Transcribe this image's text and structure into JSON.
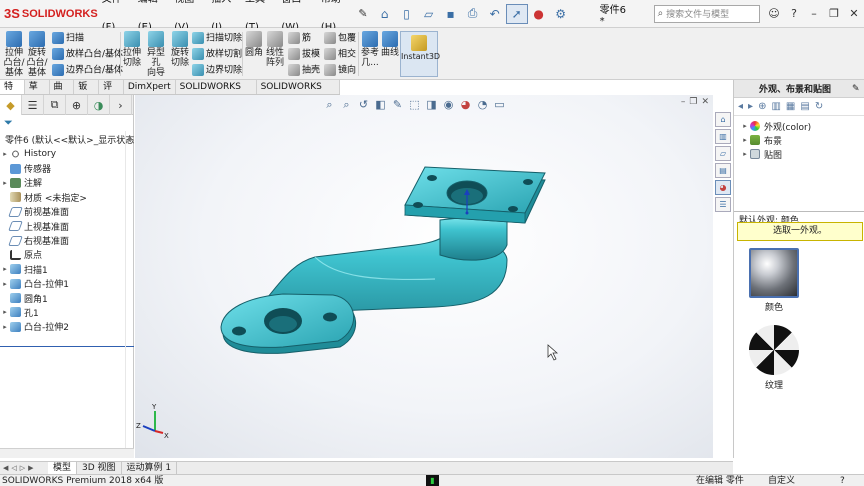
{
  "app": {
    "logo": "SOLIDWORKS",
    "logo_mark": "3S",
    "doc_title": "零件6 *",
    "search_placeholder": "搜索文件与模型"
  },
  "menu": [
    "文件(F)",
    "编辑(E)",
    "视图(V)",
    "插入(I)",
    "工具(T)",
    "窗口(W)",
    "帮助(H)"
  ],
  "ribbon": {
    "boss_extrude": [
      "拉伸",
      "凸台/",
      "基体"
    ],
    "boss_revolve": [
      "旋转",
      "凸台/",
      "基体"
    ],
    "sweep": "扫描",
    "loft": "放样凸台/基体",
    "boundary": "边界凸台/基体",
    "cut_extrude": [
      "拉伸",
      "切除"
    ],
    "hole_wizard": [
      "异型孔",
      "向导"
    ],
    "cut_revolve": [
      "旋转",
      "切除"
    ],
    "swept_cut": "扫描切除",
    "lofted_cut": "放样切割",
    "boundary_cut": "边界切除",
    "fillet": "圆角",
    "linear_pattern": [
      "线性",
      "阵列"
    ],
    "rib": "筋",
    "draft": "拔模",
    "shell": "抽壳",
    "wrap": "包覆",
    "intersect": "相交",
    "mirror": "镜向",
    "ref_geometry": [
      "参考",
      "几..."
    ],
    "curves": "曲线",
    "instant3d": "Instant3D"
  },
  "tabs": [
    "特征",
    "草图",
    "曲面",
    "钣金",
    "评估",
    "DimXpert",
    "SOLIDWORKS 插件",
    "SOLIDWORKS MBD"
  ],
  "feature_tree": {
    "root": "零件6 (默认<<默认>_显示状态",
    "items": [
      {
        "label": "History",
        "icon": "history-icon",
        "expand": true
      },
      {
        "label": "传感器",
        "icon": "sensor-icon",
        "expand": false
      },
      {
        "label": "注解",
        "icon": "annotation-icon",
        "expand": true
      },
      {
        "label": "材质 <未指定>",
        "icon": "material-icon",
        "expand": false
      },
      {
        "label": "前视基准面",
        "icon": "plane-icon",
        "expand": false
      },
      {
        "label": "上视基准面",
        "icon": "plane-icon",
        "expand": false
      },
      {
        "label": "右视基准面",
        "icon": "plane-icon",
        "expand": false
      },
      {
        "label": "原点",
        "icon": "origin-icon",
        "expand": false
      },
      {
        "label": "扫描1",
        "icon": "sweep-icon",
        "expand": true
      },
      {
        "label": "凸台-拉伸1",
        "icon": "extrude-icon",
        "expand": true
      },
      {
        "label": "圆角1",
        "icon": "fillet-icon",
        "expand": false
      },
      {
        "label": "孔1",
        "icon": "hole-icon",
        "expand": true
      },
      {
        "label": "凸台-拉伸2",
        "icon": "extrude-icon",
        "expand": true
      }
    ]
  },
  "taskpane": {
    "title": "外观、布景和贴图",
    "tree": [
      {
        "label": "外观(color)",
        "icon": "appearance-icon"
      },
      {
        "label": "布景",
        "icon": "scene-icon"
      },
      {
        "label": "贴图",
        "icon": "decal-icon"
      }
    ],
    "default_label": "默认外观: 颜色",
    "message": "选取一外观。",
    "swatches": [
      {
        "label": "颜色"
      },
      {
        "label": "纹理"
      }
    ]
  },
  "triad": {
    "x": "X",
    "y": "Y",
    "z": "Z"
  },
  "bottom_tabs": [
    "模型",
    "3D 视图",
    "运动算例 1"
  ],
  "status": {
    "product": "SOLIDWORKS Premium 2018 x64 版",
    "editing": "在编辑 零件",
    "units": "自定义"
  },
  "colors": {
    "part": "#3fc3cf",
    "brand": "#d4201f",
    "selection": "#4a70b0"
  }
}
